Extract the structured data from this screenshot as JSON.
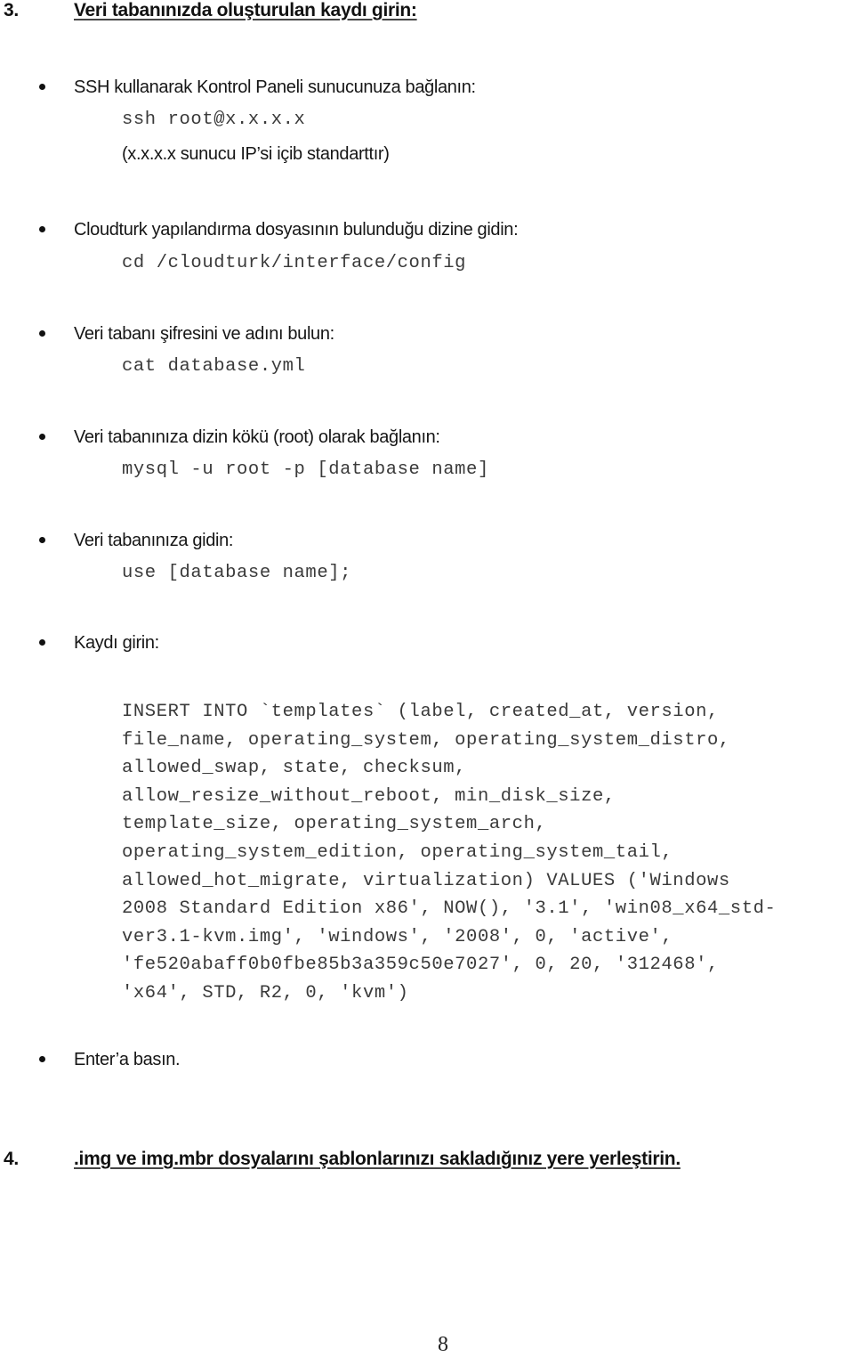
{
  "sections": [
    {
      "number": "3.",
      "title": "Veri tabanınızda oluşturulan kaydı girin:"
    },
    {
      "number": "4.",
      "title": ".img ve img.mbr dosyalarını şablonlarınızı sakladığınız yere yerleştirin."
    }
  ],
  "steps": [
    {
      "text": "SSH kullanarak Kontrol Paneli sunucunuza bağlanın:",
      "command": "ssh root@x.x.x.x",
      "note": "(x.x.x.x sunucu IP’si içib standarttır)"
    },
    {
      "text": "Cloudturk yapılandırma dosyasının bulunduğu dizine gidin:",
      "command": "cd /cloudturk/interface/config"
    },
    {
      "text": "Veri tabanı şifresini ve adını bulun:",
      "command": "cat database.yml"
    },
    {
      "text": "Veri tabanınıza dizin kökü (root) olarak bağlanın:",
      "command": "mysql -u root -p [database name]"
    },
    {
      "text": "Veri tabanınıza gidin:",
      "command": "use [database name];"
    },
    {
      "text": "Kaydı girin:",
      "sql_lines": [
        "INSERT INTO `templates` (label, created_at, version,",
        "file_name, operating_system, operating_system_distro,",
        "allowed_swap, state, checksum,",
        "allow_resize_without_reboot, min_disk_size,",
        "template_size, operating_system_arch,",
        "operating_system_edition, operating_system_tail,",
        "allowed_hot_migrate, virtualization) VALUES ('Windows",
        "2008 Standard Edition x86', NOW(), '3.1', 'win08_x64_std-",
        "ver3.1-kvm.img', 'windows', '2008', 0, 'active',",
        "'fe520abaff0b0fbe85b3a359c50e7027', 0, 20, '312468',",
        "'x64', STD, R2, 0, 'kvm')"
      ]
    },
    {
      "text": "Enter’a basın."
    }
  ],
  "footer": {
    "page_number": "8"
  }
}
